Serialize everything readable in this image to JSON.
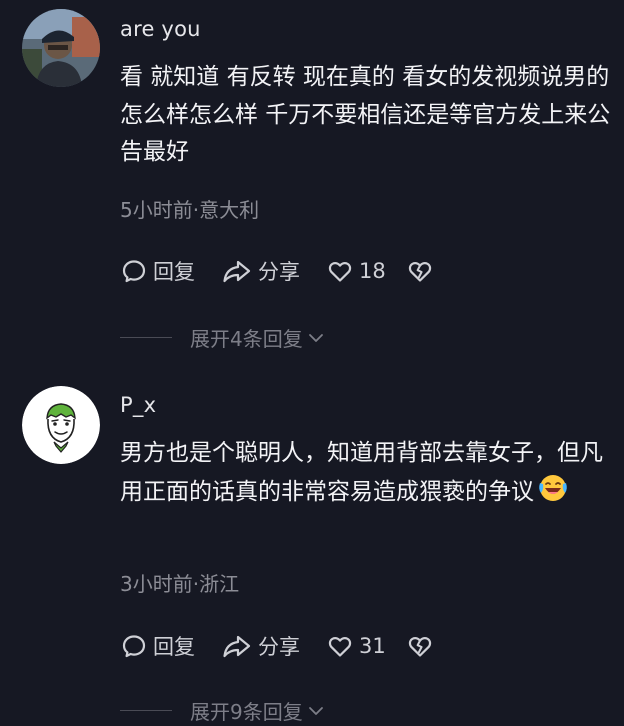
{
  "comments": [
    {
      "username": "are you",
      "text": "看 就知道 有反转 现在真的 看女的发视频说男的 怎么样怎么样 千万不要相信还是等官方发上来公告最好",
      "meta": "5小时前·意大利",
      "reply_label": "回复",
      "share_label": "分享",
      "likes": "18",
      "expand_label": "展开4条回复"
    },
    {
      "username": "P_x",
      "text": "男方也是个聪明人，知道用背部去靠女子，但凡用正面的话真的非常容易造成猥亵的争议",
      "emoji": "laughing-crying-emoji",
      "meta": "3小时前·浙江",
      "reply_label": "回复",
      "share_label": "分享",
      "likes": "31",
      "expand_label": "展开9条回复"
    }
  ],
  "colors": {
    "background": "#161823",
    "text_primary": "#f3f3f6",
    "text_secondary": "#8c8d96",
    "avatar2_bg": "#ffffff",
    "avatar2_accent": "#5fb33c"
  }
}
